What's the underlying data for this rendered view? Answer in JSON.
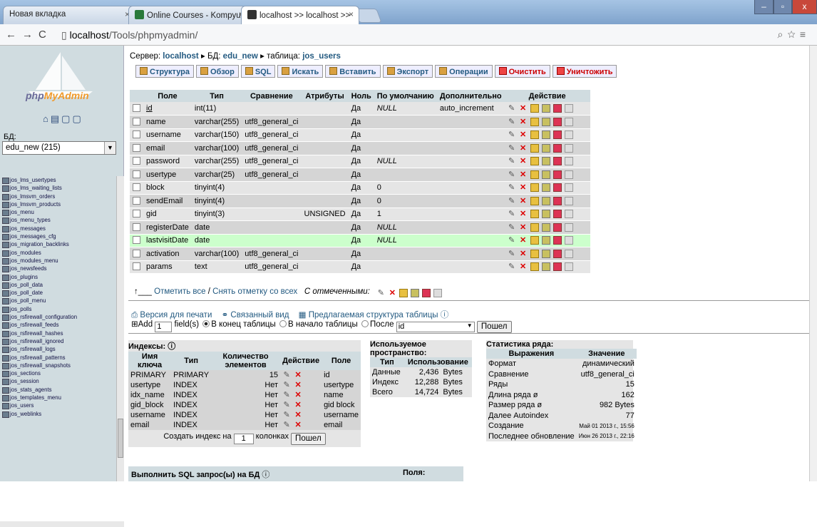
{
  "browser": {
    "tabs": [
      {
        "label": "Новая вкладка"
      },
      {
        "label": "Online Courses - Kompyu"
      },
      {
        "label": "localhost >> localhost >>"
      }
    ],
    "url_host": "localhost",
    "url_path": "/Tools/phpmyadmin/"
  },
  "sidebar": {
    "logo_text_a": "php",
    "logo_text_b": "MyAdmin",
    "db_label": "БД:",
    "db_value": "edu_new (215)",
    "tables": [
      "jos_lms_usertypes",
      "jos_lms_waiting_lists",
      "jos_lmsvm_orders",
      "jos_lmsvm_products",
      "jos_menu",
      "jos_menu_types",
      "jos_messages",
      "jos_messages_cfg",
      "jos_migration_backlinks",
      "jos_modules",
      "jos_modules_menu",
      "jos_newsfeeds",
      "jos_plugins",
      "jos_poll_data",
      "jos_poll_date",
      "jos_poll_menu",
      "jos_polls",
      "jos_rsfirewall_configuration",
      "jos_rsfirewall_feeds",
      "jos_rsfirewall_hashes",
      "jos_rsfirewall_ignored",
      "jos_rsfirewall_logs",
      "jos_rsfirewall_patterns",
      "jos_rsfirewall_snapshots",
      "jos_sections",
      "jos_session",
      "jos_stats_agents",
      "jos_templates_menu",
      "jos_users",
      "jos_weblinks"
    ]
  },
  "breadcrumb": {
    "server_label": "Сервер:",
    "server": "localhost",
    "db_label": "БД:",
    "db": "edu_new",
    "table_label": "таблица:",
    "table": "jos_users"
  },
  "menu": [
    "Структура",
    "Обзор",
    "SQL",
    "Искать",
    "Вставить",
    "Экспорт",
    "Операции",
    "Очистить",
    "Уничтожить"
  ],
  "fields": {
    "headers": [
      "Поле",
      "Тип",
      "Сравнение",
      "Атрибуты",
      "Ноль",
      "По умолчанию",
      "Дополнительно",
      "Действие"
    ],
    "rows": [
      [
        "id",
        "int(11)",
        "",
        "",
        "Да",
        "NULL",
        "auto_increment"
      ],
      [
        "name",
        "varchar(255)",
        "utf8_general_ci",
        "",
        "Да",
        "",
        ""
      ],
      [
        "username",
        "varchar(150)",
        "utf8_general_ci",
        "",
        "Да",
        "",
        ""
      ],
      [
        "email",
        "varchar(100)",
        "utf8_general_ci",
        "",
        "Да",
        "",
        ""
      ],
      [
        "password",
        "varchar(255)",
        "utf8_general_ci",
        "",
        "Да",
        "NULL",
        ""
      ],
      [
        "usertype",
        "varchar(25)",
        "utf8_general_ci",
        "",
        "Да",
        "",
        ""
      ],
      [
        "block",
        "tinyint(4)",
        "",
        "",
        "Да",
        "0",
        ""
      ],
      [
        "sendEmail",
        "tinyint(4)",
        "",
        "",
        "Да",
        "0",
        ""
      ],
      [
        "gid",
        "tinyint(3)",
        "",
        "UNSIGNED",
        "Да",
        "1",
        ""
      ],
      [
        "registerDate",
        "date",
        "",
        "",
        "Да",
        "NULL",
        ""
      ],
      [
        "lastvisitDate",
        "date",
        "",
        "",
        "Да",
        "NULL",
        ""
      ],
      [
        "activation",
        "varchar(100)",
        "utf8_general_ci",
        "",
        "Да",
        "",
        ""
      ],
      [
        "params",
        "text",
        "utf8_general_ci",
        "",
        "Да",
        "",
        ""
      ]
    ]
  },
  "check": {
    "all": "Отметить все",
    "sep": "/",
    "none": "Снять отметку со всех",
    "with": "С отмеченными:"
  },
  "links": {
    "print": "Версия для печати",
    "relation": "Связанный вид",
    "propose": "Предлагаемая структура таблицы"
  },
  "add": {
    "label": "Add",
    "count": "1",
    "fields": "field(s)",
    "opt1": "В конец таблицы",
    "opt2": "В начало таблицы",
    "opt3": "После",
    "after_value": "id",
    "go": "Пошел"
  },
  "indexes": {
    "title": "Индексы:",
    "headers": [
      "Имя ключа",
      "Тип",
      "Количество элементов",
      "Действие",
      "Поле"
    ],
    "rows": [
      [
        "PRIMARY",
        "PRIMARY",
        "15",
        "id"
      ],
      [
        "usertype",
        "INDEX",
        "Нет",
        "usertype"
      ],
      [
        "idx_name",
        "INDEX",
        "Нет",
        "name"
      ],
      [
        "gid_block",
        "INDEX",
        "Нет",
        "gid block"
      ],
      [
        "username",
        "INDEX",
        "Нет",
        "username"
      ],
      [
        "email",
        "INDEX",
        "Нет",
        "email"
      ]
    ],
    "create_a": "Создать индекс на",
    "create_n": "1",
    "create_b": "колонках",
    "go": "Пошел"
  },
  "space": {
    "title": "Используемое пространство:",
    "headers": [
      "Тип",
      "Использование"
    ],
    "rows": [
      [
        "Данные",
        "2,436",
        "Bytes"
      ],
      [
        "Индекс",
        "12,288",
        "Bytes"
      ],
      [
        "Всего",
        "14,724",
        "Bytes"
      ]
    ]
  },
  "rowstats": {
    "title": "Статистика ряда:",
    "headers": [
      "Выражения",
      "Значение"
    ],
    "rows": [
      [
        "Формат",
        "динамический"
      ],
      [
        "Сравнение",
        "utf8_general_ci"
      ],
      [
        "Ряды",
        "15"
      ],
      [
        "Длина ряда ø",
        "162"
      ],
      [
        "Размер ряда ø",
        "982 Bytes"
      ],
      [
        "Далее Autoindex",
        "77"
      ],
      [
        "Создание",
        "Май 01 2013 г., 15:56"
      ],
      [
        "Последнее обновление",
        "Июн 26 2013 г., 22:16"
      ]
    ]
  },
  "sql": {
    "title": "Выполнить SQL запрос(ы) на БД",
    "fields": "Поля:"
  }
}
